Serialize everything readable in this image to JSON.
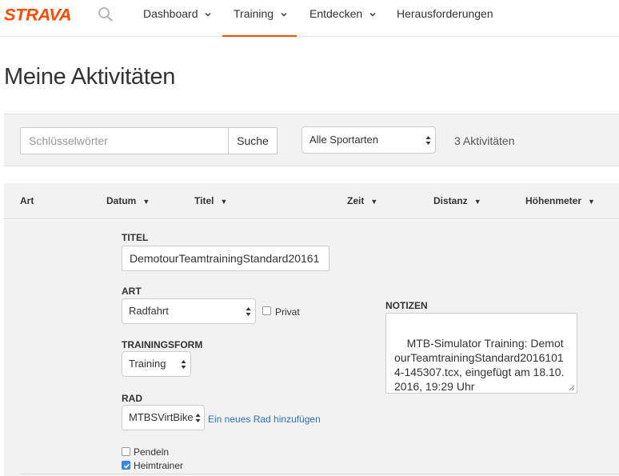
{
  "brand": {
    "logo_text": "STRAVA",
    "accent_color": "#fc4c02"
  },
  "nav": {
    "items": [
      {
        "label": "Dashboard",
        "has_dropdown": true,
        "active": false
      },
      {
        "label": "Training",
        "has_dropdown": true,
        "active": true
      },
      {
        "label": "Entdecken",
        "has_dropdown": true,
        "active": false
      },
      {
        "label": "Herausforderungen",
        "has_dropdown": false,
        "active": false
      }
    ],
    "search_icon": "search-icon"
  },
  "page": {
    "title": "Meine Aktivitäten"
  },
  "filter": {
    "keyword_placeholder": "Schlüsselwörter",
    "keyword_value": "",
    "search_button": "Suche",
    "sport_select": "Alle Sportarten",
    "activity_count": "3 Aktivitäten"
  },
  "table": {
    "headers": [
      {
        "label": "Art",
        "sortable": false
      },
      {
        "label": "Datum",
        "sortable": true
      },
      {
        "label": "Titel",
        "sortable": true
      },
      {
        "label": "Zeit",
        "sortable": true
      },
      {
        "label": "Distanz",
        "sortable": true
      },
      {
        "label": "Höhenmeter",
        "sortable": true
      }
    ]
  },
  "edit": {
    "title_label": "TITEL",
    "title_value": "DemotourTeamtrainingStandard20161",
    "type_label": "ART",
    "type_value": "Radfahrt",
    "private_label": "Privat",
    "private_checked": false,
    "workout_label": "TRAININGSFORM",
    "workout_value": "Training",
    "bike_label": "RAD",
    "bike_value": "MTBSVirtBike",
    "add_bike_link": "Ein neues Rad hinzufügen",
    "commute_label": "Pendeln",
    "commute_checked": false,
    "trainer_label": "Heimtrainer",
    "trainer_checked": true,
    "notes_label": "NOTIZEN",
    "notes_value": "MTB-Simulator Training: DemotourTeamtrainingStandard20161014-145307.tcx, eingefügt am 18.10.2016, 19:29 Uhr",
    "checkbox_color": "#3b8de0",
    "link_color": "#2a72c0"
  }
}
